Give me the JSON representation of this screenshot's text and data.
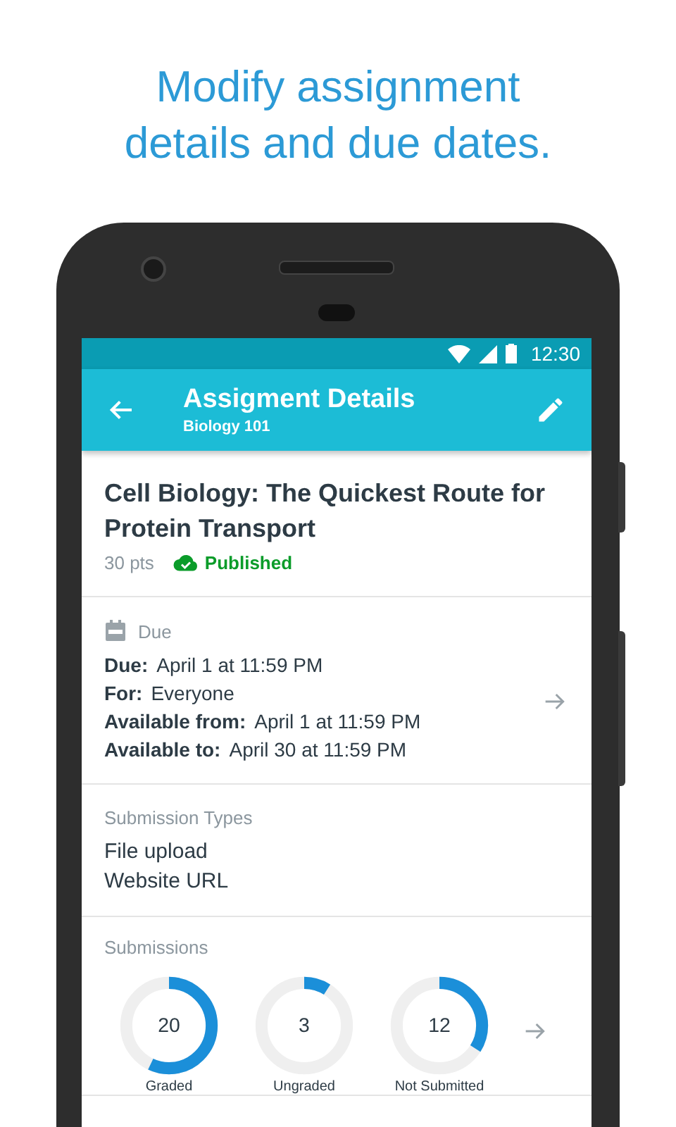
{
  "headline": "Modify assignment details and due dates.",
  "status_bar": {
    "time": "12:30"
  },
  "app_bar": {
    "title": "Assigment Details",
    "subtitle": "Biology 101"
  },
  "assignment": {
    "title": "Cell Biology: The Quickest Route for Protein Transport",
    "points": "30 pts",
    "status": "Published",
    "published": true
  },
  "due": {
    "heading": "Due",
    "rows": [
      {
        "label": "Due:",
        "value": "April 1 at 11:59 PM"
      },
      {
        "label": "For:",
        "value": "Everyone"
      },
      {
        "label": "Available from:",
        "value": "April 1 at 11:59 PM"
      },
      {
        "label": "Available to:",
        "value": "April 30 at 11:59 PM"
      }
    ]
  },
  "submission_types": {
    "heading": "Submission Types",
    "items": [
      "File upload",
      "Website URL"
    ]
  },
  "submissions": {
    "heading": "Submissions",
    "stats": [
      {
        "count": "20",
        "label": "Graded",
        "level": 0.57
      },
      {
        "count": "3",
        "label": "Ungraded",
        "level": 0.09
      },
      {
        "count": "12",
        "label": "Not Submitted",
        "level": 0.34
      }
    ]
  }
}
